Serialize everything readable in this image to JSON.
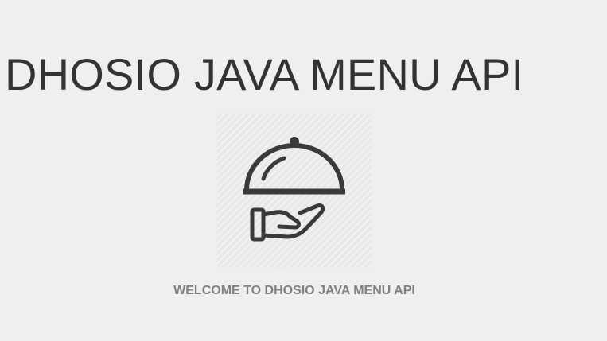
{
  "header": {
    "title": "DHOSIO JAVA MENU API"
  },
  "hero": {
    "icon": "food-tray-service-icon",
    "alt": "serving cloche on hand"
  },
  "main": {
    "welcome": "WELCOME TO DHOSIO JAVA MENU API"
  },
  "colors": {
    "background": "#efefef",
    "title": "#333333",
    "welcome": "#808080",
    "icon": "#3a3a3a"
  }
}
